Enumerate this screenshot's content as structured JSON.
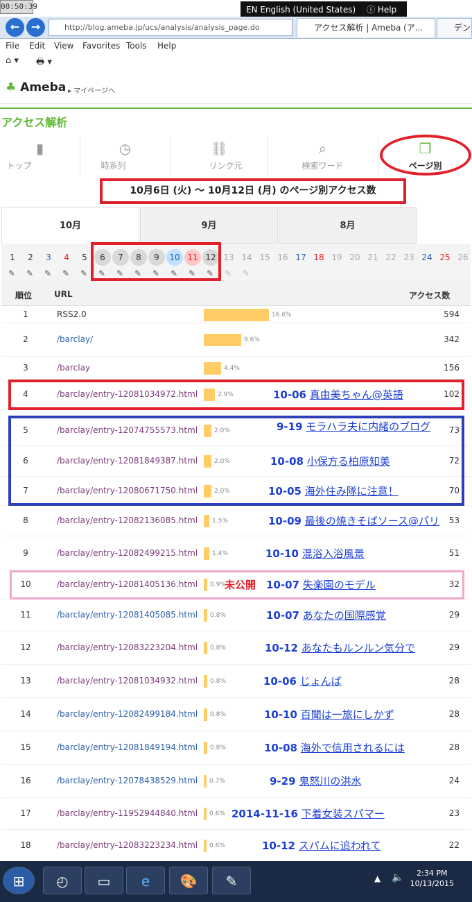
{
  "system": {
    "clock": "00:50:39",
    "language": "EN English (United States)",
    "help": "Help"
  },
  "browser": {
    "back": "←",
    "forward": "→",
    "address": "http://blog.ameba.jp/ucs/analysis/analysis_page.do",
    "tabs": [
      {
        "label": "アクセス解析 | Ameba (ア..."
      },
      {
        "label": "デンマ"
      }
    ],
    "menu": [
      "File",
      "Edit",
      "View",
      "Favorites",
      "Tools",
      "Help"
    ]
  },
  "header": {
    "logo": "Ameba",
    "mypage_link": "▸ マイページへ"
  },
  "page": {
    "title": "アクセス解析",
    "nav": [
      "トップ",
      "時系列",
      "リンク元",
      "検索ワード",
      "ページ別"
    ],
    "period": "10月6日 (火) 〜 10月12日 (月) のページ別アクセス数",
    "months": [
      "10月",
      "9月",
      "8月"
    ],
    "days": [
      "1",
      "2",
      "3",
      "4",
      "5",
      "6",
      "7",
      "8",
      "9",
      "10",
      "11",
      "12",
      "13",
      "14",
      "15",
      "16",
      "17",
      "18",
      "19",
      "20",
      "21",
      "22",
      "23",
      "24",
      "25",
      "26"
    ],
    "table_headers": {
      "rank": "順位",
      "url": "URL",
      "count": "アクセス数"
    }
  },
  "rows": [
    {
      "rank": "1",
      "url": "RSS2.0",
      "pct": "16.6%",
      "pct_value": 16.6,
      "count": "594"
    },
    {
      "rank": "2",
      "url": "/barclay/",
      "pct": "9.6%",
      "pct_value": 9.6,
      "count": "342"
    },
    {
      "rank": "3",
      "url": "/barclay",
      "pct": "4.4%",
      "pct_value": 4.4,
      "count": "156"
    },
    {
      "rank": "4",
      "url": "/barclay/entry-12081034972.html",
      "pct": "2.9%",
      "pct_value": 2.9,
      "count": "102",
      "date": "10-06",
      "title": "真由美ちゃん@英語"
    },
    {
      "rank": "5",
      "url": "/barclay/entry-12074755573.html",
      "pct": "2.0%",
      "pct_value": 2.0,
      "count": "73",
      "date": "9-19",
      "title": "モラハラ夫に内緒のブログ"
    },
    {
      "rank": "6",
      "url": "/barclay/entry-12081849387.html",
      "pct": "2.0%",
      "pct_value": 2.0,
      "count": "72",
      "date": "10-08",
      "title": "小保方る柏原知美"
    },
    {
      "rank": "7",
      "url": "/barclay/entry-12080671750.html",
      "pct": "2.0%",
      "pct_value": 2.0,
      "count": "70",
      "date": "10-05",
      "title": "海外住み隊に注意！"
    },
    {
      "rank": "8",
      "url": "/barclay/entry-12082136085.html",
      "pct": "1.5%",
      "pct_value": 1.5,
      "count": "53",
      "date": "10-09",
      "title": "最後の焼きそばソース@パリ"
    },
    {
      "rank": "9",
      "url": "/barclay/entry-12082499215.html",
      "pct": "1.4%",
      "pct_value": 1.4,
      "count": "51",
      "date": "10-10",
      "title": "混浴入浴風景"
    },
    {
      "rank": "10",
      "url": "/barclay/entry-12081405136.html",
      "pct": "0.9%",
      "pct_value": 0.9,
      "count": "32",
      "date": "10-07",
      "title": "失楽園のモデル",
      "note": "未公開"
    },
    {
      "rank": "11",
      "url": "/barclay/entry-12081405085.html",
      "pct": "0.8%",
      "pct_value": 0.8,
      "count": "29",
      "date": "10-07",
      "title": "あなたの国際感覚"
    },
    {
      "rank": "12",
      "url": "/barclay/entry-12083223204.html",
      "pct": "0.8%",
      "pct_value": 0.8,
      "count": "29",
      "date": "10-12",
      "title": "あなたもルンルン気分で"
    },
    {
      "rank": "13",
      "url": "/barclay/entry-12081034932.html",
      "pct": "0.8%",
      "pct_value": 0.8,
      "count": "28",
      "date": "10-06",
      "title": "じょんば"
    },
    {
      "rank": "14",
      "url": "/barclay/entry-12082499184.html",
      "pct": "0.8%",
      "pct_value": 0.8,
      "count": "28",
      "date": "10-10",
      "title": "百聞は一旅にしかず"
    },
    {
      "rank": "15",
      "url": "/barclay/entry-12081849194.html",
      "pct": "0.8%",
      "pct_value": 0.8,
      "count": "28",
      "date": "10-08",
      "title": "海外で信用されるには"
    },
    {
      "rank": "16",
      "url": "/barclay/entry-12078438529.html",
      "pct": "0.7%",
      "pct_value": 0.7,
      "count": "24",
      "date": "9-29",
      "title": "鬼怒川の洪水"
    },
    {
      "rank": "17",
      "url": "/barclay/entry-11952944840.html",
      "pct": "0.6%",
      "pct_value": 0.6,
      "count": "23",
      "date": "2014-11-16",
      "title": "下着女装スパマー"
    },
    {
      "rank": "18",
      "url": "/barclay/entry-12083223234.html",
      "pct": "0.6%",
      "pct_value": 0.6,
      "count": "22",
      "date": "10-12",
      "title": "スパムに追われて"
    }
  ],
  "taskbar": {
    "time": "2:34 PM",
    "date": "10/13/2015"
  },
  "colors": {
    "ameba_green": "#5fb833",
    "bar": "#ffcc66",
    "annotation_blue": "#1c3fd3",
    "highlight_red": "#e0202a",
    "highlight_blue": "#2b3fb8",
    "highlight_pink": "#f0a8c8"
  }
}
